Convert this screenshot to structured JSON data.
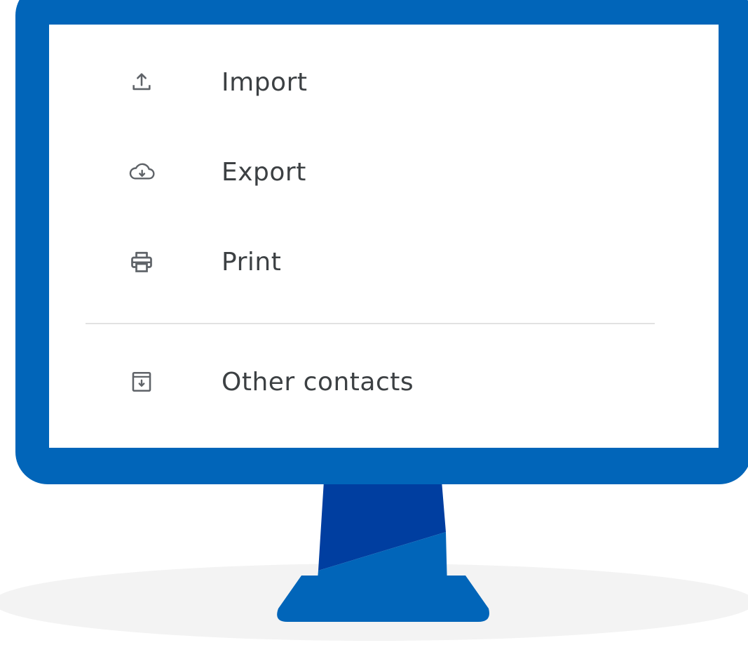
{
  "menu": {
    "items": [
      {
        "label": "Import",
        "icon": "upload-icon"
      },
      {
        "label": "Export",
        "icon": "cloud-download-icon"
      },
      {
        "label": "Print",
        "icon": "printer-icon"
      },
      {
        "label": "Other contacts",
        "icon": "archive-download-icon"
      }
    ]
  },
  "colors": {
    "monitor_frame": "#0165b9",
    "stand_dark": "#003ea0",
    "stand_light": "#0165b9",
    "icon": "#5f6368",
    "text": "#3c4043",
    "floor": "#f3f3f3",
    "divider": "#e2e2e2"
  }
}
